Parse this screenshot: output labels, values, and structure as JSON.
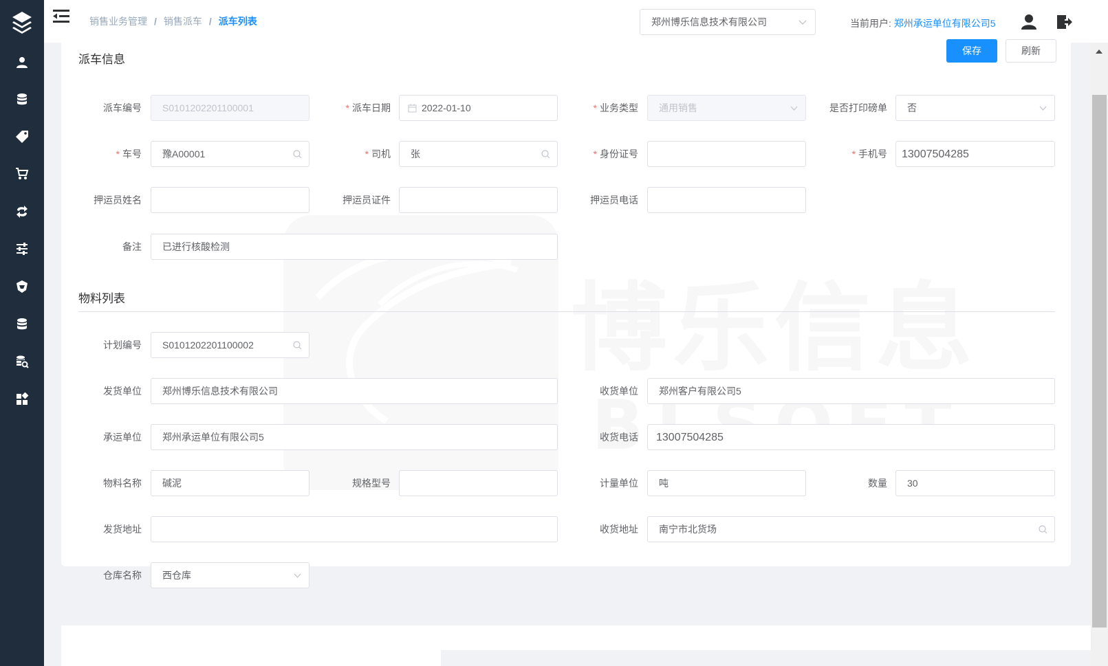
{
  "breadcrumb": [
    "销售业务管理",
    "销售派车",
    "派车列表"
  ],
  "header": {
    "company": "郑州博乐信息技术有限公司",
    "current_user_label": "当前用户:",
    "current_user": "郑州承运单位有限公司5"
  },
  "sidebar": {
    "icons": [
      "layers-icon",
      "users-icon",
      "database-icon",
      "tag-icon",
      "cart-icon",
      "exchange-icon",
      "sliders-icon",
      "shield-icon",
      "database-icon",
      "search-doc-icon",
      "apps-icon"
    ]
  },
  "dispatch": {
    "section_title": "派车信息",
    "save_label": "保存",
    "refresh_label": "刷新",
    "dispatch_no_label": "派车编号",
    "dispatch_no": "S0101202201100001",
    "dispatch_date_label": "派车日期",
    "dispatch_date": "2022-01-10",
    "biz_type_label": "业务类型",
    "biz_type": "通用销售",
    "print_weigh_label": "是否打印磅单",
    "print_weigh": "否",
    "car_no_label": "车号",
    "car_no": "豫A00001",
    "driver_label": "司机",
    "driver": "张",
    "id_no_label": "身份证号",
    "id_no": "",
    "phone_label": "手机号",
    "phone": "13007504285",
    "escort_name_label": "押运员姓名",
    "escort_name": "",
    "escort_id_label": "押运员证件",
    "escort_id": "",
    "escort_phone_label": "押运员电话",
    "escort_phone": "",
    "remark_label": "备注",
    "remark": "已进行核酸检测"
  },
  "materials": {
    "section_title": "物料列表",
    "plan_no_label": "计划编号",
    "plan_no": "S0101202201100002",
    "sender_label": "发货单位",
    "sender": "郑州博乐信息技术有限公司",
    "receiver_label": "收货单位",
    "receiver": "郑州客户有限公司5",
    "carrier_label": "承运单位",
    "carrier": "郑州承运单位有限公司5",
    "receiver_phone_label": "收货电话",
    "receiver_phone": "13007504285",
    "material_name_label": "物料名称",
    "material_name": "碱泥",
    "spec_label": "规格型号",
    "spec": "",
    "unit_label": "计量单位",
    "unit": "吨",
    "qty_label": "数量",
    "qty": "30",
    "send_addr_label": "发货地址",
    "send_addr": "",
    "recv_addr_label": "收货地址",
    "recv_addr": "南宁市北货场",
    "warehouse_label": "仓库名称",
    "warehouse": "西仓库"
  },
  "watermark": {
    "text_cn": "博乐信息",
    "text_en": "BLSOFT"
  }
}
